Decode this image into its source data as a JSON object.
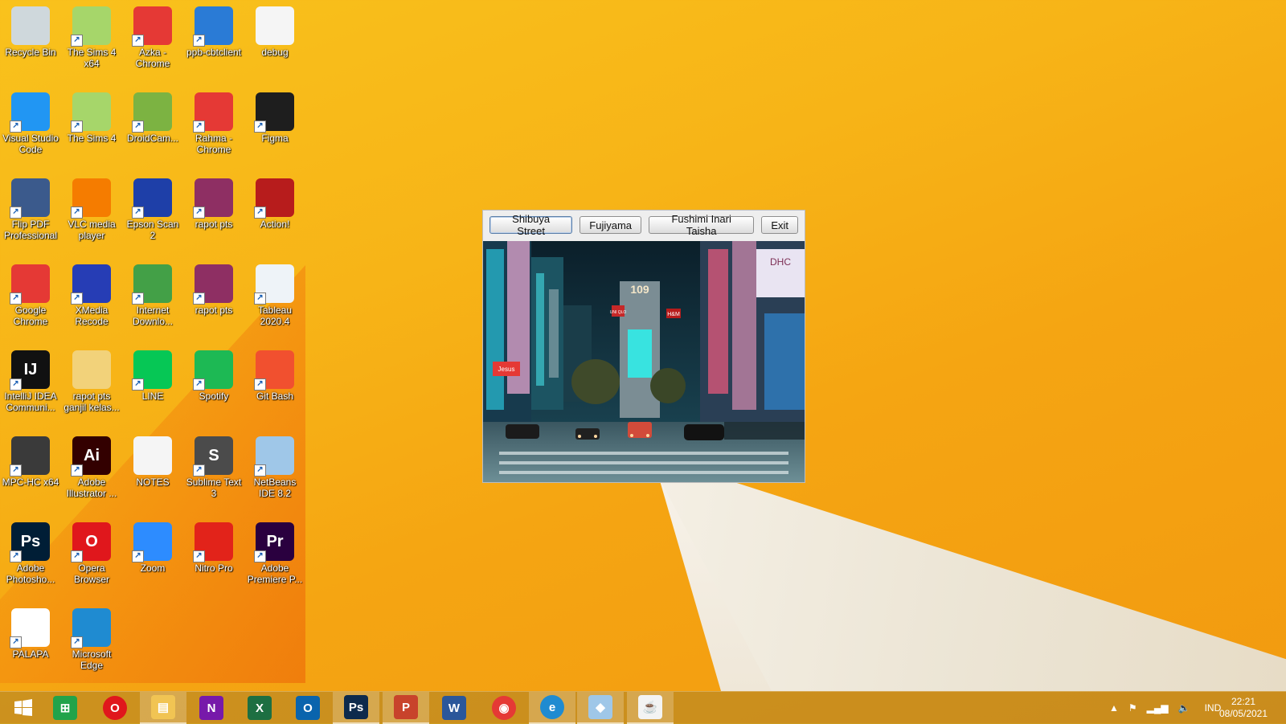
{
  "desktop": {
    "icons": [
      {
        "label": "Recycle Bin",
        "icon": "recycle-bin-icon",
        "color": "#cfd8dc"
      },
      {
        "label": "The Sims 4 x64",
        "icon": "sims-icon",
        "color": "#a6d66a"
      },
      {
        "label": "Azka - Chrome",
        "icon": "chrome-profile-icon",
        "color": "#e53935"
      },
      {
        "label": "ppb-cbtclient",
        "icon": "ppb-icon",
        "color": "#2a7bd6"
      },
      {
        "label": "debug",
        "icon": "text-file-icon",
        "color": "#f5f5f5"
      },
      {
        "label": "Visual Studio Code",
        "icon": "vscode-icon",
        "color": "#2196f3"
      },
      {
        "label": "The Sims 4",
        "icon": "sims-icon",
        "color": "#a6d66a"
      },
      {
        "label": "DroidCam...",
        "icon": "droidcam-icon",
        "color": "#7cb342"
      },
      {
        "label": "Rahma - Chrome",
        "icon": "chrome-profile-icon",
        "color": "#e53935"
      },
      {
        "label": "Figma",
        "icon": "figma-icon",
        "color": "#1e1e1e"
      },
      {
        "label": "Flip PDF Professional",
        "icon": "flip-pdf-icon",
        "color": "#3b5a8c"
      },
      {
        "label": "VLC media player",
        "icon": "vlc-icon",
        "color": "#f57c00"
      },
      {
        "label": "Epson Scan 2",
        "icon": "epson-scan-icon",
        "color": "#1e3fa8"
      },
      {
        "label": "rapot pts",
        "icon": "winrar-icon",
        "color": "#8e2f63"
      },
      {
        "label": "Action!",
        "icon": "action-icon",
        "color": "#b71c1c"
      },
      {
        "label": "Google Chrome",
        "icon": "chrome-icon",
        "color": "#e53935"
      },
      {
        "label": "XMedia Recode",
        "icon": "xmedia-icon",
        "color": "#263db5"
      },
      {
        "label": "Internet Downlo...",
        "icon": "idm-icon",
        "color": "#43a047"
      },
      {
        "label": "rapot pts",
        "icon": "winrar-icon",
        "color": "#8e2f63"
      },
      {
        "label": "Tableau 2020.4",
        "icon": "tableau-icon",
        "color": "#eef3f8"
      },
      {
        "label": "IntelliJ IDEA Communi...",
        "icon": "intellij-icon",
        "color": "#111111"
      },
      {
        "label": "rapot pts ganjil kelas...",
        "icon": "folder-icon",
        "color": "#f2d27a"
      },
      {
        "label": "LINE",
        "icon": "line-icon",
        "color": "#06c755"
      },
      {
        "label": "Spotify",
        "icon": "spotify-icon",
        "color": "#1db954"
      },
      {
        "label": "Git Bash",
        "icon": "git-bash-icon",
        "color": "#f1502f"
      },
      {
        "label": "MPC-HC x64",
        "icon": "mpc-hc-icon",
        "color": "#3a3a3a"
      },
      {
        "label": "Adobe Illustrator ...",
        "icon": "illustrator-icon",
        "color": "#330000"
      },
      {
        "label": "NOTES",
        "icon": "text-file-icon",
        "color": "#f5f5f5"
      },
      {
        "label": "Sublime Text 3",
        "icon": "sublime-icon",
        "color": "#4b4b4b"
      },
      {
        "label": "NetBeans IDE 8.2",
        "icon": "netbeans-icon",
        "color": "#9fc7e8"
      },
      {
        "label": "Adobe Photosho...",
        "icon": "photoshop-icon",
        "color": "#001e36"
      },
      {
        "label": "Opera Browser",
        "icon": "opera-icon",
        "color": "#e0171c"
      },
      {
        "label": "Zoom",
        "icon": "zoom-icon",
        "color": "#2d8cff"
      },
      {
        "label": "Nitro Pro",
        "icon": "nitro-icon",
        "color": "#e2231a"
      },
      {
        "label": "Adobe Premiere P...",
        "icon": "premiere-icon",
        "color": "#2a003f"
      },
      {
        "label": "PALAPA",
        "icon": "palapa-icon",
        "color": "#ffffff"
      },
      {
        "label": "Microsoft Edge",
        "icon": "edge-icon",
        "color": "#1f8bd1"
      }
    ],
    "icon_glyphs": [
      "",
      "",
      "",
      "",
      "",
      "",
      "",
      "",
      "",
      "",
      "",
      "",
      "",
      "",
      "",
      "",
      "",
      "",
      "",
      "",
      "IJ",
      "",
      "",
      "",
      "",
      "",
      "Ai",
      "",
      "S",
      "",
      "Ps",
      "O",
      "",
      "",
      "Pr",
      "",
      ""
    ]
  },
  "app_window": {
    "buttons": [
      {
        "label": "Shibuya Street"
      },
      {
        "label": "Fujiyama"
      },
      {
        "label": "Fushimi Inari Taisha"
      },
      {
        "label": "Exit"
      }
    ],
    "photo_signs": [
      "109",
      "UNI QLO",
      "H&M",
      "DHC",
      "Jesus"
    ]
  },
  "taskbar": {
    "items": [
      {
        "icon": "windows-start-icon",
        "color": "#ffffff",
        "glyph": ""
      },
      {
        "icon": "store-icon",
        "color": "#22a34a",
        "glyph": "⊞"
      },
      {
        "icon": "opera-icon",
        "color": "#e0171c",
        "glyph": "O"
      },
      {
        "icon": "file-explorer-icon",
        "color": "#f1c453",
        "glyph": "▤"
      },
      {
        "icon": "onenote-icon",
        "color": "#7719aa",
        "glyph": "N"
      },
      {
        "icon": "excel-icon",
        "color": "#1d6f42",
        "glyph": "X"
      },
      {
        "icon": "outlook-icon",
        "color": "#0a64ad",
        "glyph": "O"
      },
      {
        "icon": "photoshop-icon",
        "color": "#0d2a4c",
        "glyph": "Ps"
      },
      {
        "icon": "powerpoint-icon",
        "color": "#c8432b",
        "glyph": "P"
      },
      {
        "icon": "word-icon",
        "color": "#2b579a",
        "glyph": "W"
      },
      {
        "icon": "chrome-icon",
        "color": "#e53935",
        "glyph": "◉"
      },
      {
        "icon": "edge-icon",
        "color": "#1f8bd1",
        "glyph": "e"
      },
      {
        "icon": "netbeans-icon",
        "color": "#9fc7e8",
        "glyph": "◆"
      },
      {
        "icon": "java-icon",
        "color": "#f3f3f3",
        "glyph": "☕"
      }
    ],
    "tray": {
      "language": "IND",
      "time": "22:21",
      "date": "08/05/2021"
    }
  }
}
